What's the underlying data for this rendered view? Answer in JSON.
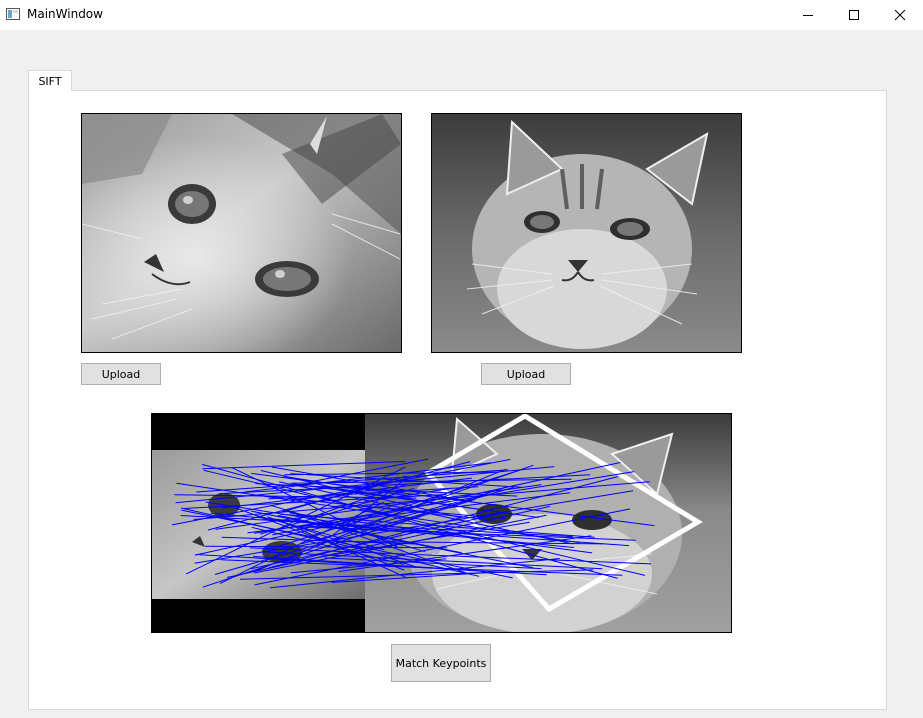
{
  "window": {
    "title": "MainWindow"
  },
  "tabs": [
    {
      "label": "SIFT"
    }
  ],
  "left_image": {
    "upload_label": "Upload"
  },
  "right_image": {
    "upload_label": "Upload"
  },
  "match": {
    "button_label": "Match Keypoints"
  }
}
